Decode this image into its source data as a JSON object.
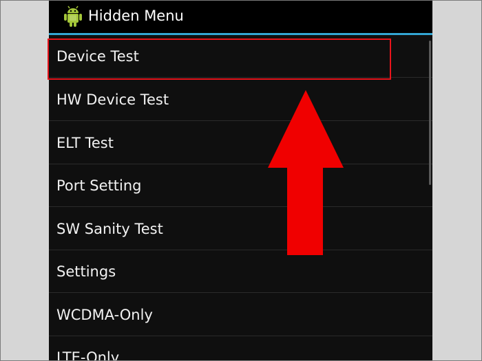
{
  "header": {
    "title": "Hidden Menu",
    "app_icon": "android-robot-icon"
  },
  "menu": {
    "items": [
      {
        "label": "Device Test"
      },
      {
        "label": "HW Device Test"
      },
      {
        "label": "ELT Test"
      },
      {
        "label": "Port Setting"
      },
      {
        "label": "SW Sanity Test"
      },
      {
        "label": "Settings"
      },
      {
        "label": "WCDMA-Only"
      },
      {
        "label": "LTE-Only"
      }
    ]
  },
  "annotation": {
    "highlighted_item": "Device Test",
    "highlight_color": "#e8141b",
    "arrow_color": "#f00000",
    "arrow_direction": "up"
  },
  "colors": {
    "accent_line": "#33a6d4",
    "background": "#0f0f0f"
  }
}
